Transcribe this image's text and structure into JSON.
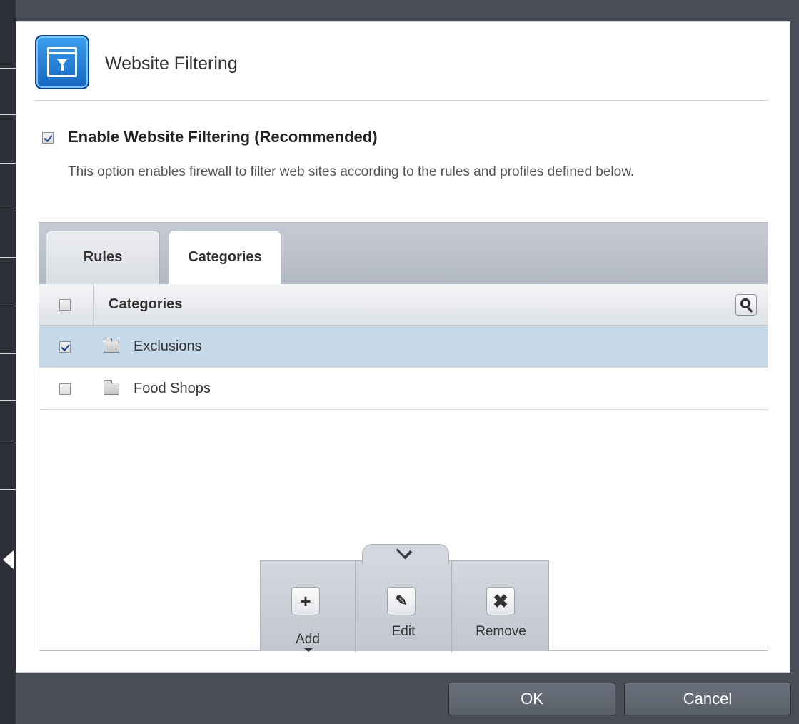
{
  "dialog": {
    "title": "Website Filtering",
    "icon": "website-filtering-icon"
  },
  "enable": {
    "label": "Enable Website Filtering (Recommended)",
    "checked": true,
    "description": "This option enables firewall to filter web sites according to the rules and profiles defined below."
  },
  "tabs": {
    "rules": "Rules",
    "categories": "Categories",
    "active": "Categories"
  },
  "list": {
    "column_header": "Categories",
    "header_checked": false,
    "rows": [
      {
        "label": "Exclusions",
        "checked": true,
        "selected": true,
        "icon": "folder-icon"
      },
      {
        "label": "Food Shops",
        "checked": false,
        "selected": false,
        "icon": "folder-icon"
      }
    ]
  },
  "toolbar": {
    "add": "Add",
    "edit": "Edit",
    "remove": "Remove",
    "add_glyph": "+",
    "edit_glyph": "✎",
    "remove_glyph": "✖"
  },
  "buttons": {
    "ok": "OK",
    "cancel": "Cancel"
  },
  "colors": {
    "selected_row": "#c5d9e8",
    "button_bg": "#5f6570",
    "icon_blue": "#1e7fd6"
  }
}
